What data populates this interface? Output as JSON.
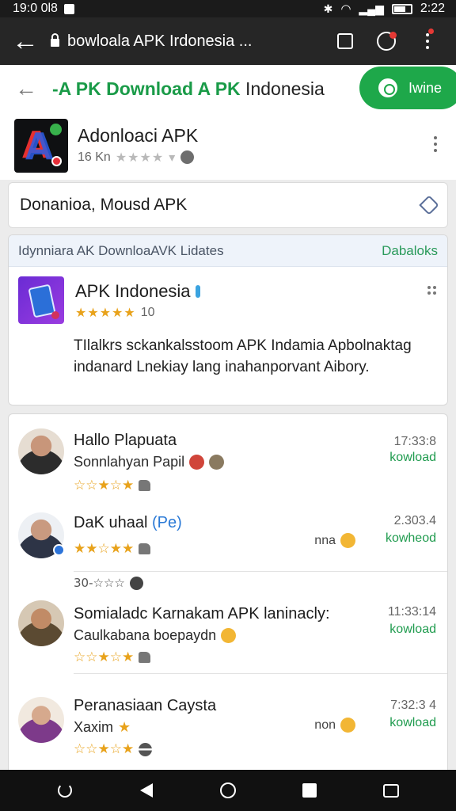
{
  "status_bar": {
    "time_left": "19:0 0l8",
    "time_right": "2:22"
  },
  "browser": {
    "url_text": "bowloala APK Irdonesia ..."
  },
  "site_header": {
    "title_green": "-A PK Download A PK",
    "title_dark": " Indonesia",
    "win_label": "Iwine"
  },
  "app": {
    "name": "Adonloaci APK",
    "meta_count": "16 Kn",
    "meta_stars": "★★★★ ▾"
  },
  "search": {
    "value": "Donanioa, Mousd APK"
  },
  "featured": {
    "header_text": "Idynniara AK DownloaAVK  Lidates",
    "header_link": "Dabaloks",
    "title": "APK Indonesia",
    "stars": "★★★★★",
    "rating_count": "10",
    "description": "TIlalkrs sckankalsstoom APK Indamia Apbolnaktag indanard Lnekiay lang inahanporvant Aibory."
  },
  "reviews": [
    {
      "name": "Hallo Plapuata",
      "name_tag": "",
      "sub": "Sonnlahyan Papil",
      "stars": "☆☆★☆★",
      "time": "17:33:8",
      "download": "kowload",
      "side": ""
    },
    {
      "name": "DaK uhaal",
      "name_tag": "(Pe)",
      "sub": "",
      "stars": "★★☆★★",
      "time": "2.303.4",
      "download": "kowheod",
      "side": "nna",
      "extra_line": "30-☆☆☆"
    },
    {
      "name": "Somialadc Karnakam APK laninacly:",
      "name_tag": "",
      "sub": "Caulkabana boepaydn",
      "stars": "☆☆★☆★",
      "time": "11:33:14",
      "download": "kowload",
      "side": ""
    },
    {
      "name": "Peranasiaan Caysta",
      "name_tag": "",
      "sub": "Xaxim",
      "stars": "☆☆★☆★",
      "time": "7:32:3 4",
      "download": "kowload",
      "side": "non"
    }
  ],
  "colors": {
    "green": "#1ea84a",
    "gold": "#e8a21b",
    "link_blue": "#2a79d6"
  }
}
